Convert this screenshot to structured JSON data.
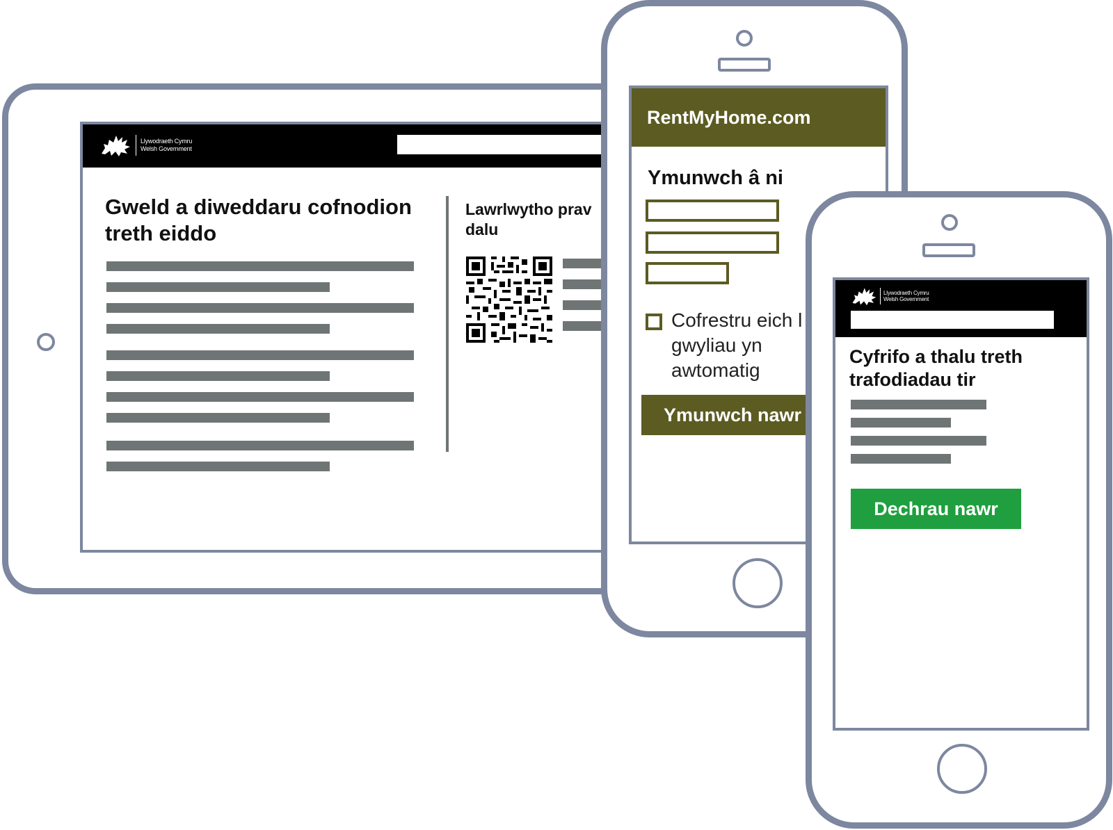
{
  "tablet": {
    "brand": {
      "line1": "Llywodraeth Cymru",
      "line2": "Welsh Government"
    },
    "page_title": "Gweld a diweddaru cofnodion treth eiddo",
    "sidebar_heading_line1": "Lawrlwytho prav",
    "sidebar_heading_line2": "dalu"
  },
  "phone1": {
    "site_name": "RentMyHome.com",
    "form_heading": "Ymunwch â ni",
    "checkbox_label_line1": "Cofrestru eich l",
    "checkbox_label_line2": "gwyliau yn",
    "checkbox_label_line3": "awtomatig",
    "button_label": "Ymunwch nawr"
  },
  "phone2": {
    "brand": {
      "line1": "Llywodraeth Cymru",
      "line2": "Welsh Government"
    },
    "page_title": "Cyfrifo a thalu treth trafodiadau tir",
    "button_label": "Dechrau nawr"
  },
  "colors": {
    "device_frame": "#7d879f",
    "placeholder_text_lines": "#6f7575",
    "rent_brand_olive": "#5c5b22",
    "gov_header": "#000000",
    "start_button_green": "#1f9f3f"
  }
}
